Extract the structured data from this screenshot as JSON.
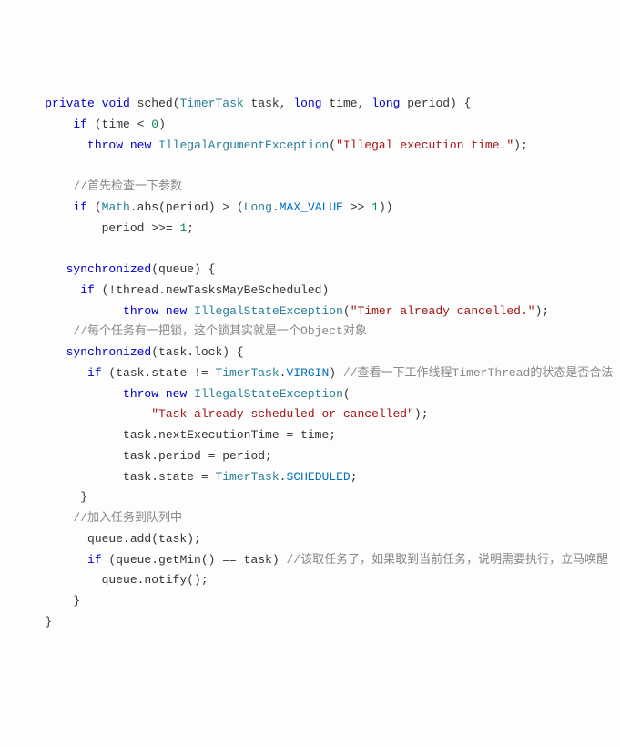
{
  "code": {
    "l1": {
      "kw1": "private",
      "kw2": "void",
      "fn": "sched",
      "type1": "TimerTask",
      "p1": "task,",
      "kw3": "long",
      "p2": "time,",
      "kw4": "long",
      "p3": "period)",
      "brace": "{"
    },
    "l2": {
      "kw1": "if",
      "cond": "(time <",
      "num": "0",
      "close": ")"
    },
    "l3": {
      "kw1": "throw",
      "kw2": "new",
      "type": "IllegalArgumentException",
      "paren": "(",
      "str": "\"Illegal execution time.\"",
      "end": ");"
    },
    "l4": "",
    "l5": {
      "cm": "//首先检查一下参数"
    },
    "l6": {
      "kw1": "if",
      "open": "(",
      "type1": "Math",
      "dot1": ".abs(period) > (",
      "type2": "Long",
      "dot2": ".",
      "const": "MAX_VALUE",
      "shift": " >>",
      "num": " 1",
      "close": "))"
    },
    "l7": {
      "txt": "period >>=",
      "num": " 1",
      "semi": ";"
    },
    "l8": "",
    "l9": {
      "kw1": "synchronized",
      "txt": "(queue) {"
    },
    "l10": {
      "kw1": "if",
      "txt": " (!thread.newTasksMayBeScheduled)"
    },
    "l11": {
      "kw1": "throw",
      "kw2": "new",
      "type": "IllegalStateException",
      "paren": "(",
      "str": "\"Timer already cancelled.\"",
      "end": ");"
    },
    "l12": {
      "cm": "//每个任务有一把锁，这个锁其实就是一个Object对象"
    },
    "l13": {
      "kw1": "synchronized",
      "txt": "(task.lock) {"
    },
    "l14": {
      "kw1": "if",
      "txt1": " (task.state != ",
      "type": "TimerTask",
      "dot": ".",
      "const": "VIRGIN",
      "close": ")",
      "cm": " //查看一下工作线程TimerThread的状态是否合法"
    },
    "l15": {
      "kw1": "throw",
      "kw2": "new",
      "type": "IllegalStateException",
      "paren": "("
    },
    "l16": {
      "str": "\"Task already scheduled or cancelled\"",
      "end": ");"
    },
    "l17": {
      "txt": "task.nextExecutionTime = time;"
    },
    "l18": {
      "txt": "task.period = period;"
    },
    "l19": {
      "txt1": "task.state = ",
      "type": "TimerTask",
      "dot": ".",
      "const": "SCHEDULED",
      "semi": ";"
    },
    "l20": {
      "brace": "}"
    },
    "l21": {
      "cm": "//加入任务到队列中"
    },
    "l22": {
      "txt": "queue.add(task);"
    },
    "l23": {
      "kw1": "if",
      "txt": " (queue.getMin() == task)",
      "cm": " //该取任务了，如果取到当前任务，说明需要执行，立马唤醒"
    },
    "l24": {
      "txt": "queue.notify();"
    },
    "l25": {
      "brace": "}"
    },
    "l26": {
      "brace": "}"
    }
  }
}
